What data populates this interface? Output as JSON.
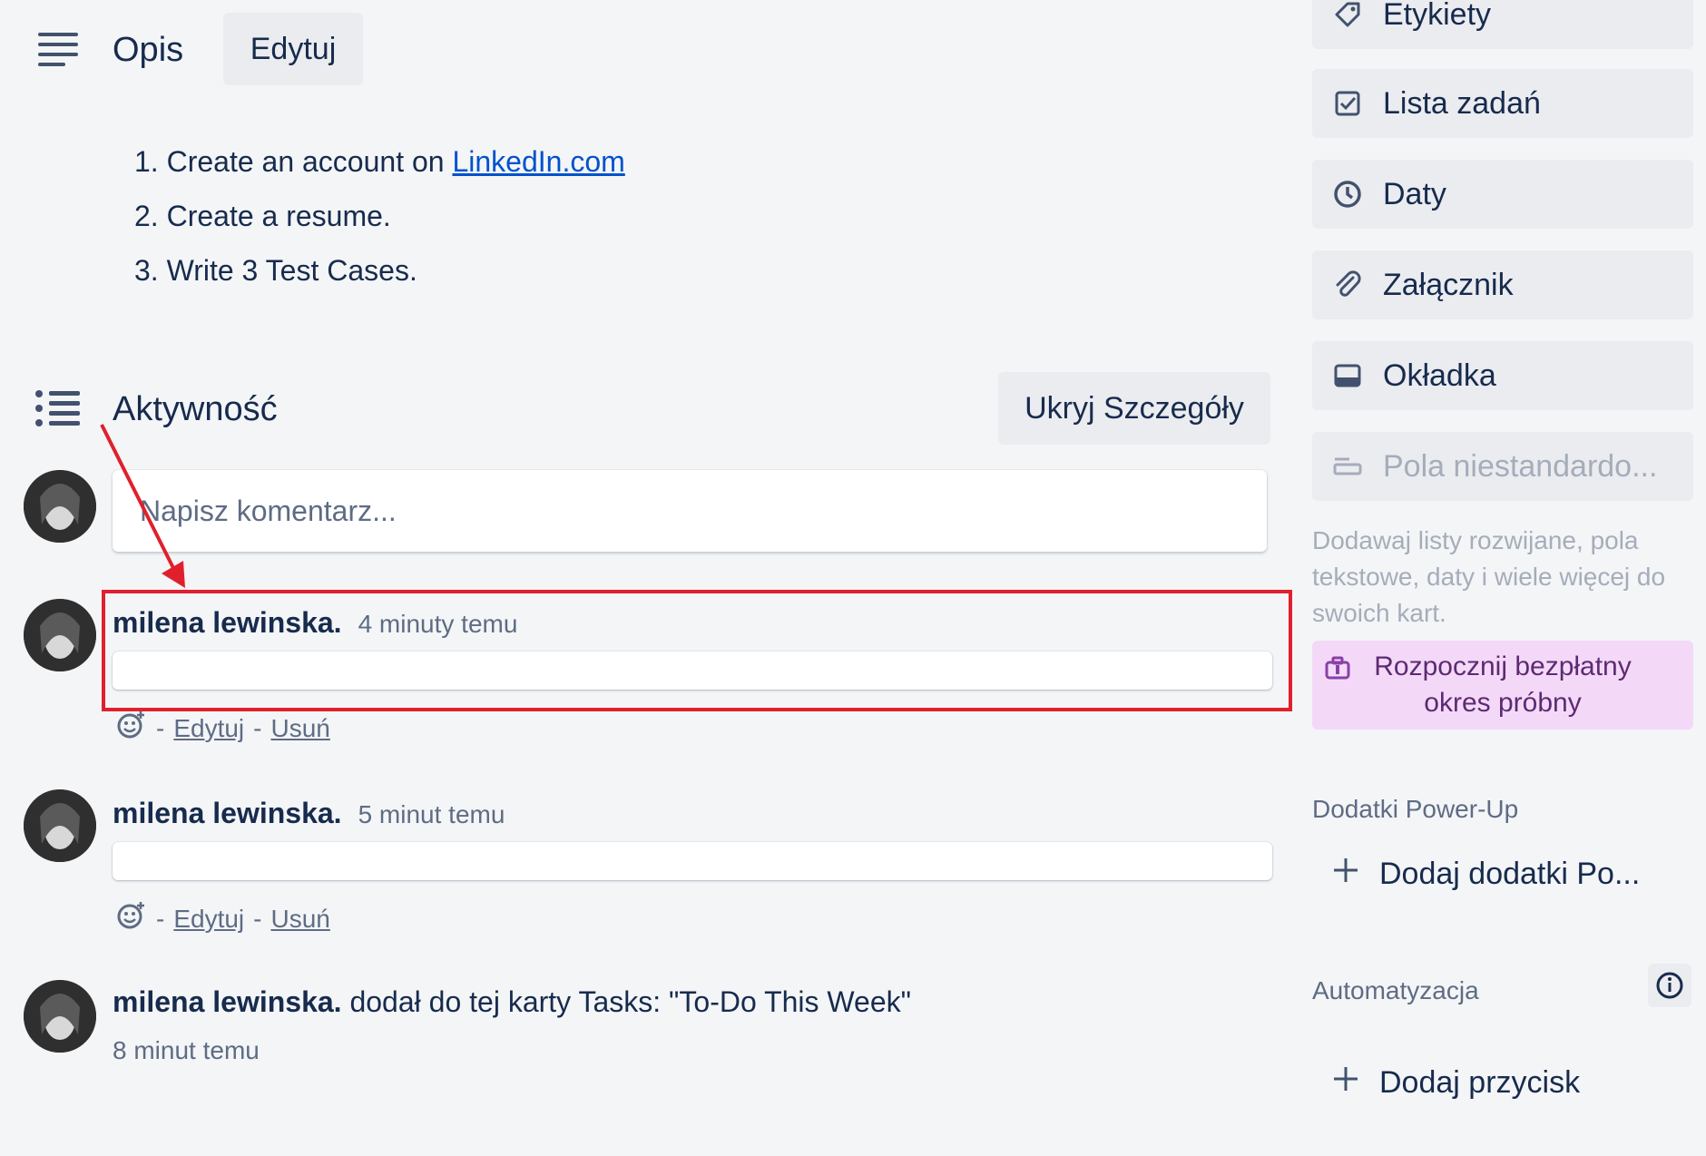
{
  "description": {
    "title": "Opis",
    "edit_label": "Edytuj",
    "items": [
      {
        "number": "1.",
        "text": "Create an account on ",
        "link": "LinkedIn.com"
      },
      {
        "number": "2.",
        "text": "Create a resume.",
        "link": ""
      },
      {
        "number": "3.",
        "text": "Write 3 Test Cases.",
        "link": ""
      }
    ]
  },
  "activity": {
    "title": "Aktywność",
    "hide_details_label": "Ukryj Szczegóły",
    "comment_placeholder": "Napisz komentarz...",
    "entries": [
      {
        "author": "milena lewinska.",
        "time": "4 minuty temu",
        "edit": "Edytuj",
        "delete": "Usuń",
        "separator": "-"
      },
      {
        "author": "milena lewinska.",
        "time": "5 minut temu",
        "edit": "Edytuj",
        "delete": "Usuń",
        "separator": "-"
      }
    ],
    "event": {
      "author": "milena lewinska.",
      "text": "dodał do tej karty Tasks: \"To-Do This Week\"",
      "time": "8 minut temu"
    }
  },
  "sidebar": {
    "buttons": [
      {
        "label": "Etykiety",
        "icon": "label-icon"
      },
      {
        "label": "Lista zadań",
        "icon": "checklist-icon"
      },
      {
        "label": "Daty",
        "icon": "clock-icon"
      },
      {
        "label": "Załącznik",
        "icon": "paperclip-icon"
      },
      {
        "label": "Okładka",
        "icon": "cover-icon"
      },
      {
        "label": "Pola niestandardo...",
        "icon": "custom-fields-icon"
      }
    ],
    "custom_fields_note": "Dodawaj listy rozwijane, pola tekstowe, daty i wiele więcej do swoich kart.",
    "trial_button": "Rozpocznij bezpłatny okres próbny",
    "powerups_heading": "Dodatki Power-Up",
    "add_powerups": "Dodaj dodatki Po...",
    "automation_heading": "Automatyzacja",
    "add_button": "Dodaj przycisk"
  },
  "colors": {
    "highlight": "#e0202d",
    "link": "#0052cc",
    "trial_bg": "#f3d9f7"
  }
}
